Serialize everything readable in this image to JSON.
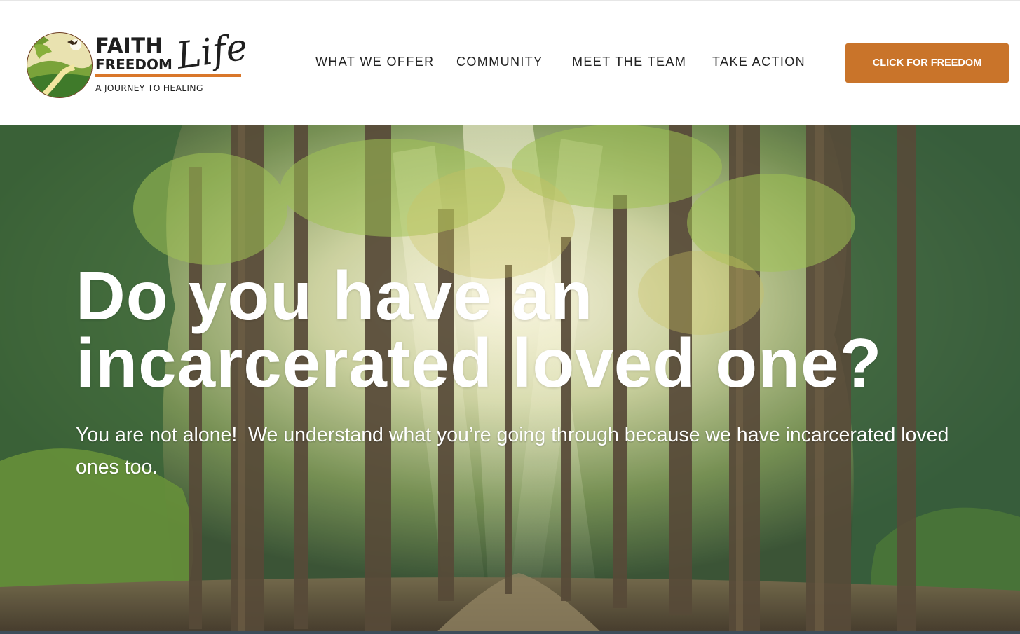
{
  "logo": {
    "line1": "FAITH",
    "line2": "FREEDOM",
    "script": "Life",
    "tagline": "A JOURNEY TO HEALING"
  },
  "nav": {
    "items": [
      {
        "label": "WHAT WE OFFER"
      },
      {
        "label": "COMMUNITY"
      },
      {
        "label": "MEET THE TEAM"
      },
      {
        "label": "TAKE ACTION"
      }
    ]
  },
  "cta": {
    "label": "CLICK FOR FREEDOM"
  },
  "hero": {
    "title": "Do you have an incarcerated loved one?",
    "subtitle": "You are not alone!  We understand what you’re going through because we have incarcerated loved ones too."
  },
  "colors": {
    "accent": "#c9742a",
    "logo_bar": "#d9772a",
    "text_dark": "#222222",
    "hero_text": "#ffffff"
  }
}
